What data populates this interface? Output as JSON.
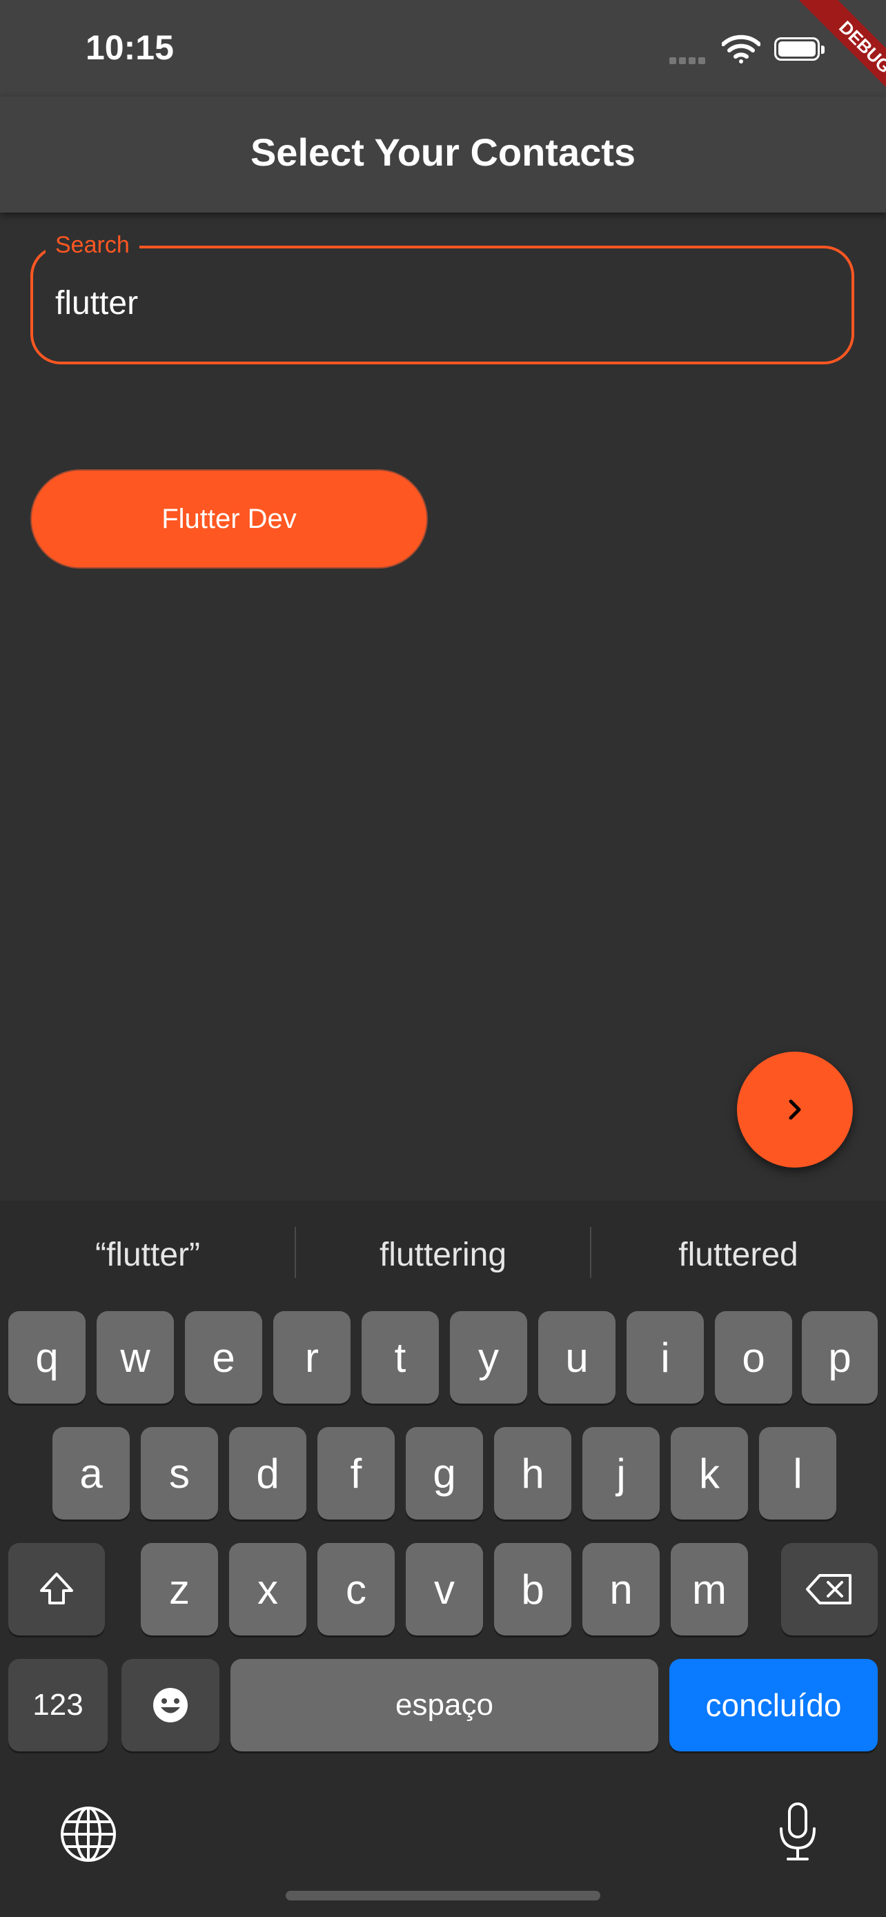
{
  "status_bar": {
    "time": "10:15"
  },
  "debug_banner": "DEBUG",
  "app_bar": {
    "title": "Select Your Contacts"
  },
  "search": {
    "label": "Search",
    "value": "flutter"
  },
  "contacts": [
    {
      "name": "Flutter Dev"
    }
  ],
  "fab": {
    "icon": "chevron-right-icon"
  },
  "keyboard": {
    "suggestions": [
      "“flutter”",
      "fluttering",
      "fluttered"
    ],
    "row1": [
      "q",
      "w",
      "e",
      "r",
      "t",
      "y",
      "u",
      "i",
      "o",
      "p"
    ],
    "row2": [
      "a",
      "s",
      "d",
      "f",
      "g",
      "h",
      "j",
      "k",
      "l"
    ],
    "row3": [
      "z",
      "x",
      "c",
      "v",
      "b",
      "n",
      "m"
    ],
    "numbers_key": "123",
    "space_key": "espaço",
    "done_key": "concluído"
  },
  "colors": {
    "accent": "#ff5722",
    "background": "#303030",
    "app_bar": "#424242",
    "done_key": "#0a7aff"
  }
}
